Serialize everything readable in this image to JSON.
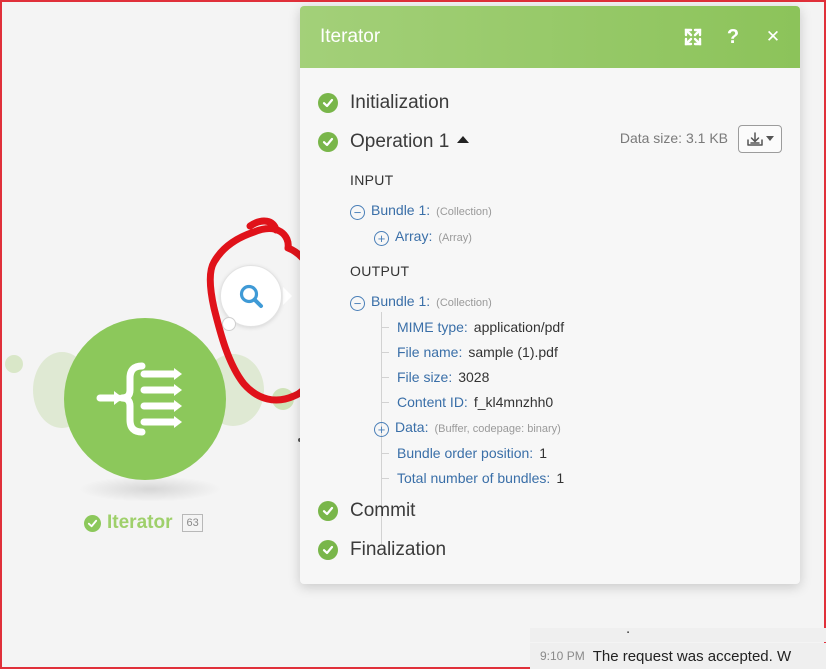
{
  "panel": {
    "title": "Iterator",
    "header_icons": [
      "expand-icon",
      "help-icon",
      "close-icon"
    ],
    "help_glyph": "?",
    "close_glyph": "✕",
    "sections": {
      "initialization": "Initialization",
      "operation": "Operation 1",
      "commit": "Commit",
      "finalization": "Finalization"
    },
    "data_size": "Data size: 3.1 KB",
    "input": {
      "heading": "INPUT",
      "bundle": {
        "key": "Bundle 1:",
        "type": "(Collection)"
      },
      "array": {
        "key": "Array:",
        "type": "(Array)"
      }
    },
    "output": {
      "heading": "OUTPUT",
      "bundle": {
        "key": "Bundle 1:",
        "type": "(Collection)"
      },
      "fields": [
        {
          "key": "MIME type:",
          "value": "application/pdf"
        },
        {
          "key": "File name:",
          "value": "sample (1).pdf"
        },
        {
          "key": "File size:",
          "value": "3028"
        },
        {
          "key": "Content ID:",
          "value": "f_kl4mnzhh0"
        }
      ],
      "data": {
        "key": "Data:",
        "type": "(Buffer, codepage: binary)"
      },
      "bundle_order": {
        "key": "Bundle order position:",
        "value": "1"
      },
      "total_bundles": {
        "key": "Total number of bundles:",
        "value": "1"
      }
    }
  },
  "module": {
    "name": "Iterator",
    "count": "63"
  },
  "chat": {
    "time": "9:10 PM",
    "text": "The request was accepted. W"
  },
  "colors": {
    "header_green": "#8cc35a",
    "module_green": "#8cc85b",
    "check_green": "#79b64a",
    "link_blue": "#3a6fa8",
    "annotation_red": "#e0121a"
  }
}
